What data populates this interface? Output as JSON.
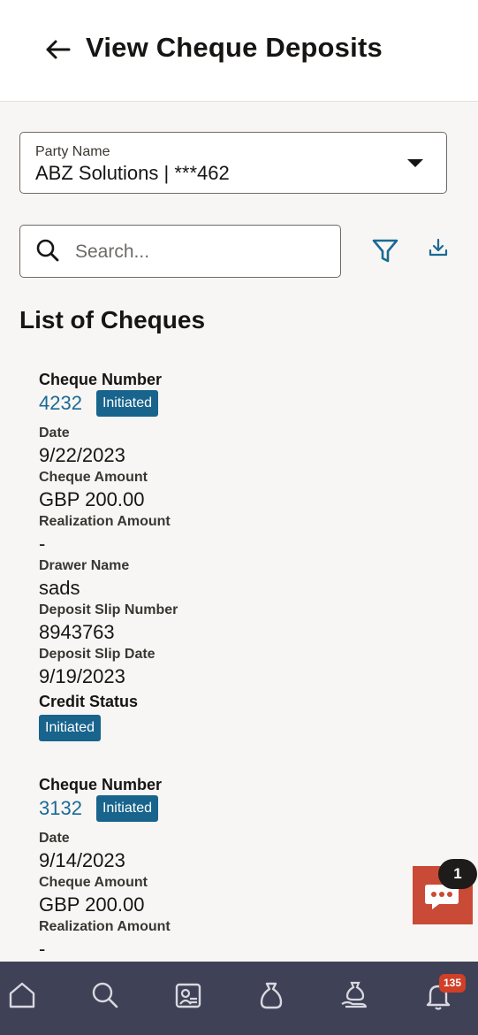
{
  "header": {
    "title": "View Cheque Deposits"
  },
  "party": {
    "label": "Party Name",
    "value": "ABZ Solutions | ***462"
  },
  "search": {
    "placeholder": "Search..."
  },
  "toolbar": {
    "filter_icon": "filter-icon",
    "download_icon": "download-icon"
  },
  "list": {
    "title": "List of Cheques",
    "cheques": [
      {
        "number_label": "Cheque Number",
        "number": "4232",
        "status": "Initiated",
        "date_label": "Date",
        "date": "9/22/2023",
        "amount_label": "Cheque Amount",
        "amount": "GBP 200.00",
        "realization_label": "Realization Amount",
        "realization": "-",
        "drawer_label": "Drawer Name",
        "drawer": "sads",
        "slip_label": "Deposit Slip Number",
        "slip": "8943763",
        "slip_date_label": "Deposit Slip Date",
        "slip_date": "9/19/2023",
        "credit_label": "Credit Status",
        "credit_status": "Initiated"
      },
      {
        "number_label": "Cheque Number",
        "number": "3132",
        "status": "Initiated",
        "date_label": "Date",
        "date": "9/14/2023",
        "amount_label": "Cheque Amount",
        "amount": "GBP 200.00",
        "realization_label": "Realization Amount",
        "realization": "-"
      }
    ]
  },
  "chat": {
    "count": "1",
    "icon": "chat-icon"
  },
  "bottom_nav": {
    "items": [
      "home-icon",
      "search-icon",
      "portfolio-icon",
      "money-bag-icon",
      "hand-coin-icon",
      "bell-icon"
    ],
    "notifications": "135"
  },
  "colors": {
    "accent": "#1a6a95",
    "badge": "#18648c",
    "nav": "#3f4157",
    "chat": "#c94a36",
    "alert": "#d03f27"
  }
}
